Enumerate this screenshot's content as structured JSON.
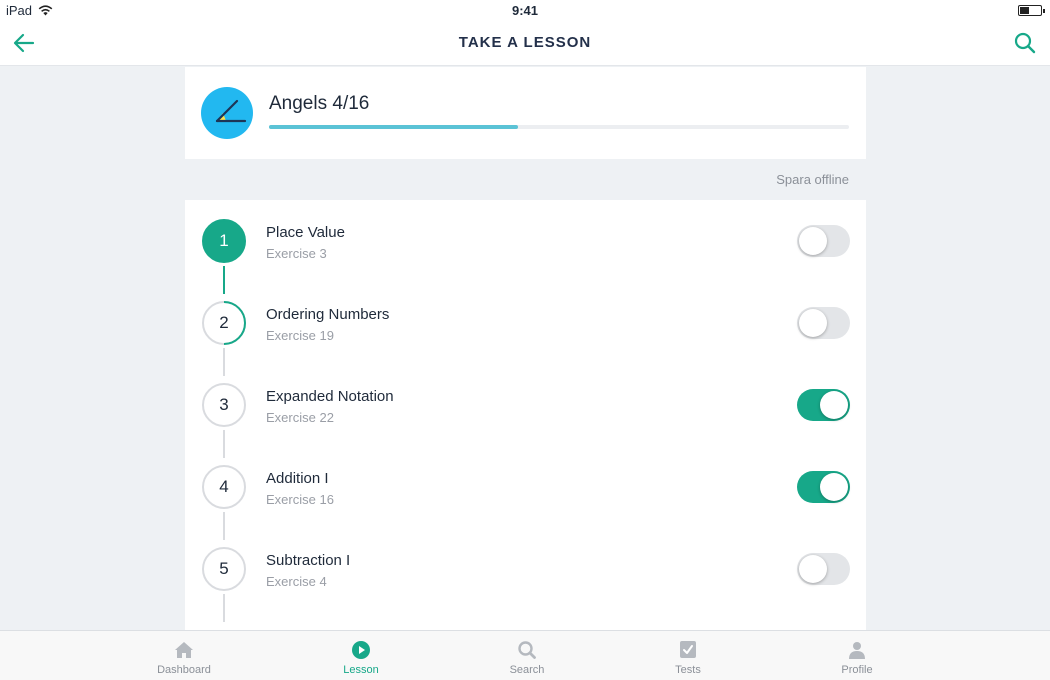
{
  "status_bar": {
    "device": "iPad",
    "time": "9:41"
  },
  "nav": {
    "title": "TAKE A LESSON",
    "back_icon": "arrow-left-icon",
    "search_icon": "search-icon"
  },
  "colors": {
    "accent": "#17a889",
    "progress": "#5bc3d6",
    "course_icon_bg": "#22b8f0"
  },
  "course": {
    "title": "Angels 4/16",
    "progress": 0.43
  },
  "save_offline_label": "Spara offline",
  "lessons": [
    {
      "number": "1",
      "title": "Place Value",
      "subtitle": "Exercise 3",
      "state": "done",
      "offline": false
    },
    {
      "number": "2",
      "title": "Ordering Numbers",
      "subtitle": "Exercise 19",
      "state": "partial",
      "offline": false
    },
    {
      "number": "3",
      "title": "Expanded Notation",
      "subtitle": "Exercise 22",
      "state": "todo",
      "offline": true
    },
    {
      "number": "4",
      "title": "Addition I",
      "subtitle": "Exercise 16",
      "state": "todo",
      "offline": true
    },
    {
      "number": "5",
      "title": "Subtraction I",
      "subtitle": "Exercise 4",
      "state": "todo",
      "offline": false
    }
  ],
  "tabs": [
    {
      "label": "Dashboard",
      "icon": "home-icon",
      "active": false
    },
    {
      "label": "Lesson",
      "icon": "play-icon",
      "active": true
    },
    {
      "label": "Search",
      "icon": "search-icon",
      "active": false
    },
    {
      "label": "Tests",
      "icon": "checkbox-icon",
      "active": false
    },
    {
      "label": "Profile",
      "icon": "person-icon",
      "active": false
    }
  ]
}
